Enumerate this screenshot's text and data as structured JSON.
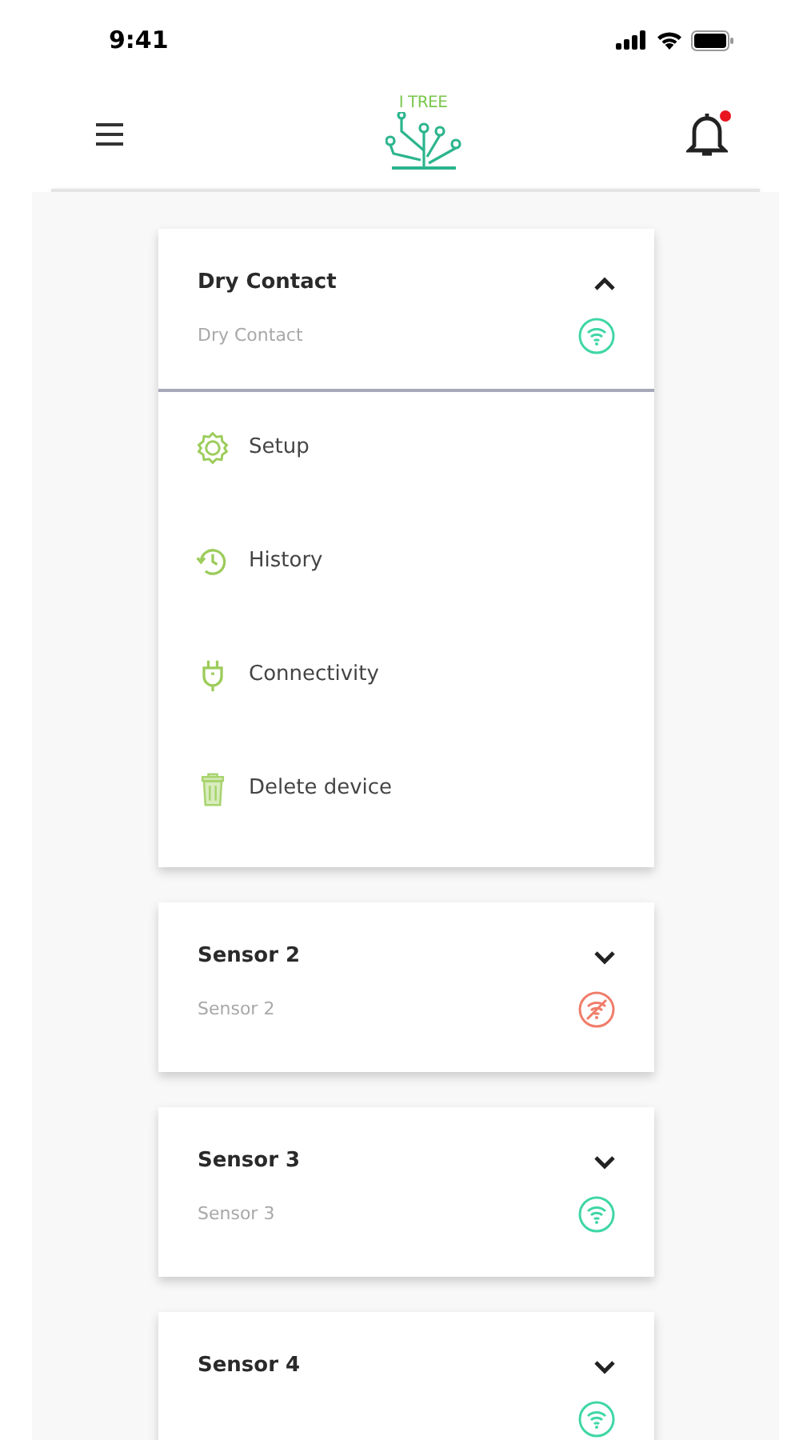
{
  "status_bar": {
    "time": "9:41"
  },
  "app_bar": {
    "logo_text": "I TREE",
    "notification_badge": true
  },
  "devices": [
    {
      "title": "Dry Contact",
      "subtitle": "Dry Contact",
      "connected": true,
      "expanded": true,
      "menu": [
        {
          "kind": "setup",
          "label": "Setup"
        },
        {
          "kind": "history",
          "label": "History"
        },
        {
          "kind": "connectivity",
          "label": "Connectivity"
        },
        {
          "kind": "delete",
          "label": "Delete device"
        }
      ]
    },
    {
      "title": "Sensor 2",
      "subtitle": "Sensor 2",
      "connected": false,
      "expanded": false
    },
    {
      "title": "Sensor 3",
      "subtitle": "Sensor 3",
      "connected": true,
      "expanded": false
    },
    {
      "title": "Sensor 4",
      "connected": true,
      "expanded": false
    }
  ]
}
